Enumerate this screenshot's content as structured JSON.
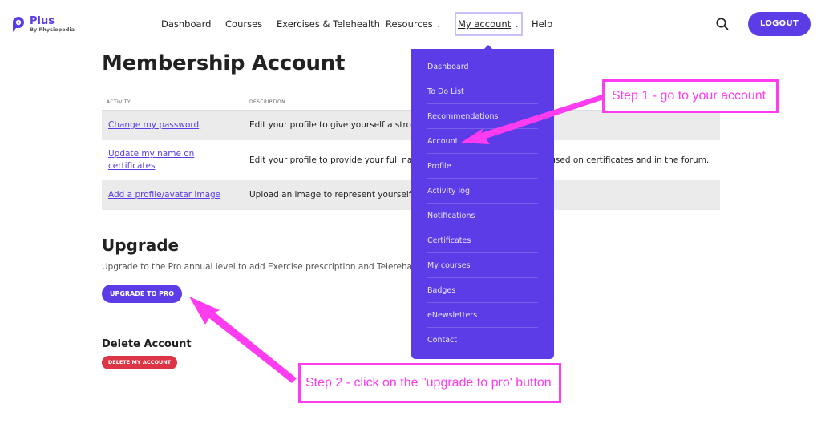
{
  "brand": {
    "title": "Plus",
    "subtitle": "By Physiopedia",
    "color": "#5b3ce6"
  },
  "nav": {
    "items": [
      {
        "label": "Dashboard"
      },
      {
        "label": "Courses"
      },
      {
        "label": "Exercises & Telehealth"
      },
      {
        "label": "Resources",
        "has_dropdown": true
      },
      {
        "label": "My account",
        "has_dropdown": true,
        "active": true
      },
      {
        "label": "Help"
      }
    ],
    "chevron": "⌄",
    "search_icon": "search-icon",
    "logout_label": "LOGOUT"
  },
  "main": {
    "title": "Membership Account",
    "table": {
      "headers": [
        "ACTIVITY",
        "DESCRIPTION"
      ],
      "rows": [
        {
          "activity": "Change my password",
          "description": "Edit your profile to give yourself a strong"
        },
        {
          "activity": "Update my name on certificates",
          "description": "Edit your profile to provide your full nan                                              is used on certificates and in the forum."
        },
        {
          "activity": "Add a profile/avatar image",
          "description": "Upload an image to represent yourself i"
        }
      ]
    },
    "upgrade": {
      "title": "Upgrade",
      "description": "Upgrade to the Pro annual level to add Exercise prescription and Telerehabil",
      "button_label": "UPGRADE TO PRO"
    },
    "delete": {
      "title": "Delete Account",
      "button_label": "DELETE MY ACCOUNT"
    }
  },
  "dropdown": {
    "items": [
      "Dashboard",
      "To Do List",
      "Recommendations",
      "Account",
      "Profile",
      "Activity log",
      "Notifications",
      "Certificates",
      "My courses",
      "Badges",
      "eNewsletters",
      "Contact"
    ]
  },
  "annotations": {
    "step1": "Step 1 - go to your account",
    "step2": "Step 2 - click on the \"upgrade to pro' button",
    "color": "#ff3cf0"
  }
}
